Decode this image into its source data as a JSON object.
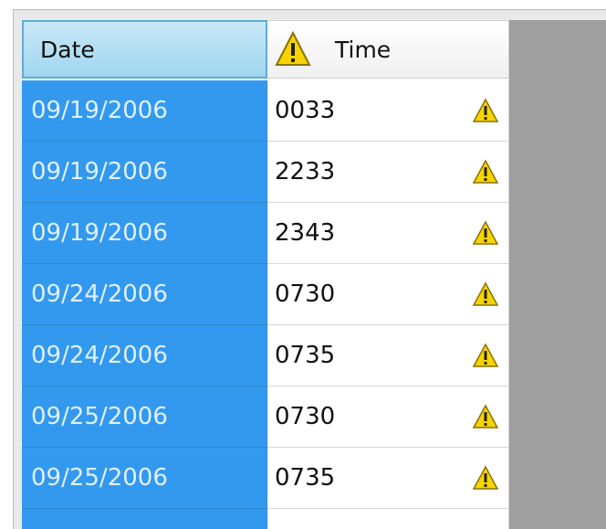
{
  "grid": {
    "columns": {
      "date_header": "Date",
      "time_header": "Time"
    },
    "rows": [
      {
        "date": "09/19/2006",
        "time": "0033"
      },
      {
        "date": "09/19/2006",
        "time": "2233"
      },
      {
        "date": "09/19/2006",
        "time": "2343"
      },
      {
        "date": "09/24/2006",
        "time": "0730"
      },
      {
        "date": "09/24/2006",
        "time": "0735"
      },
      {
        "date": "09/25/2006",
        "time": "0730"
      },
      {
        "date": "09/25/2006",
        "time": "0735"
      }
    ],
    "icons": {
      "header_time": "warning-icon",
      "row_time": "warning-icon"
    },
    "colors": {
      "selected_cell": "#3399ee",
      "header_selected": "#9fd6f0",
      "warning": "#f2d200"
    }
  }
}
